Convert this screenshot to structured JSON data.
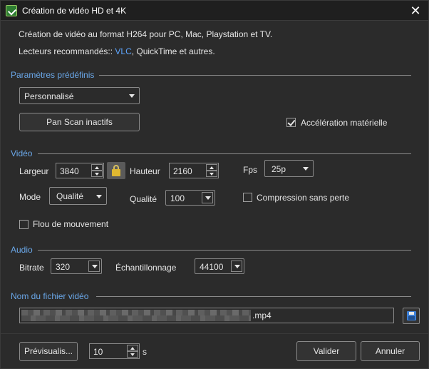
{
  "window": {
    "title": "Création de vidéo HD et 4K",
    "close_symbol": "✕"
  },
  "intro": {
    "line1": "Création de vidéo au format H264 pour PC, Mac, Playstation et TV.",
    "line2_prefix": "Lecteurs recommandés:: ",
    "line2_link": "VLC",
    "line2_suffix": ", QuickTime et autres."
  },
  "presets": {
    "section_title": "Paramètres prédéfinis",
    "profile_selected": "Personnalisé",
    "pan_scan_button": "Pan  Scan inactifs",
    "hw_accel_label": "Accélération matérielle",
    "hw_accel_checked": true
  },
  "video": {
    "section_title": "Vidéo",
    "width_label": "Largeur",
    "width_value": "3840",
    "height_label": "Hauteur",
    "height_value": "2160",
    "fps_label": "Fps",
    "fps_value": "25p",
    "mode_label": "Mode",
    "mode_value": "Qualité",
    "quality_label": "Qualité",
    "quality_value": "100",
    "lossless_label": "Compression sans perte",
    "lossless_checked": false,
    "motion_blur_label": "Flou de mouvement",
    "motion_blur_checked": false
  },
  "audio": {
    "section_title": "Audio",
    "bitrate_label": "Bitrate",
    "bitrate_value": "320",
    "sampling_label": "Échantillonnage",
    "sampling_value": "44100"
  },
  "file": {
    "section_title": "Nom du fichier vidéo",
    "extension": ".mp4"
  },
  "footer": {
    "preview_button": "Prévisualis...",
    "preview_seconds": "10",
    "seconds_unit": "s",
    "ok_button": "Valider",
    "cancel_button": "Annuler"
  }
}
